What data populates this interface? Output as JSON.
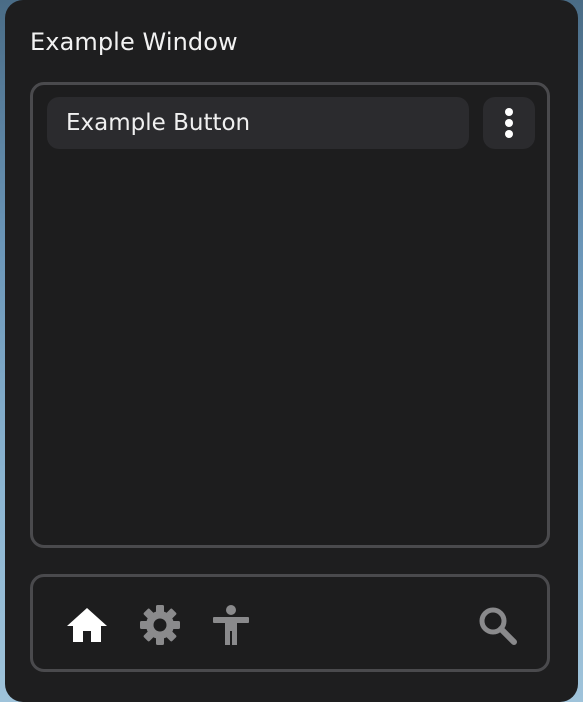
{
  "window": {
    "title": "Example Window"
  },
  "content": {
    "example_button_label": "Example Button",
    "more_button_icon": "more-vertical-icon"
  },
  "nav": {
    "items": [
      {
        "icon": "home-icon",
        "active": true
      },
      {
        "icon": "gear-icon",
        "active": false
      },
      {
        "icon": "accessibility-icon",
        "active": false
      },
      {
        "icon": "search-icon",
        "active": false
      }
    ]
  },
  "colors": {
    "window_bg": "#1e1e1f",
    "panel_border": "#4a4a4d",
    "button_bg": "#2b2b2e",
    "text": "#f2f2f2",
    "icon_active": "#ffffff",
    "icon_inactive": "#8a8a8c"
  }
}
